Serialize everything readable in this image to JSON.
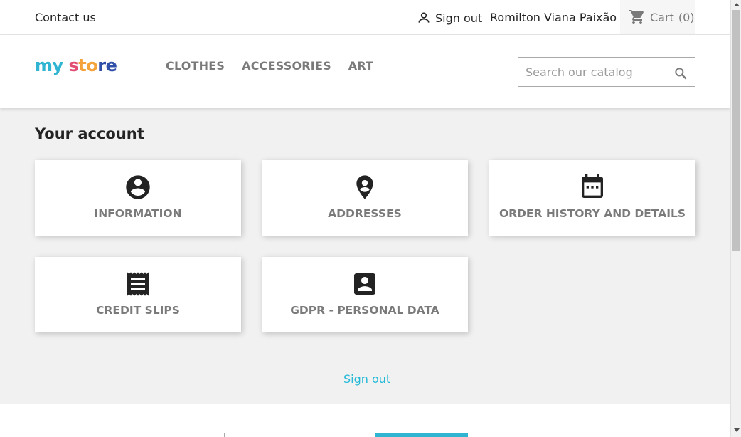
{
  "topbar": {
    "contact_label": "Contact us",
    "signout_label": "Sign out",
    "user_name": "Romilton Viana Paixão",
    "cart_label": "Cart",
    "cart_count": "(0)"
  },
  "header": {
    "logo_parts": [
      "my",
      " s",
      "to",
      "re"
    ],
    "nav": [
      {
        "label": "CLOTHES"
      },
      {
        "label": "ACCESSORIES"
      },
      {
        "label": "ART"
      }
    ],
    "search": {
      "placeholder": "Search our catalog",
      "value": ""
    }
  },
  "main": {
    "title": "Your account",
    "tiles": [
      {
        "label": "INFORMATION",
        "icon": "account-circle-icon"
      },
      {
        "label": "ADDRESSES",
        "icon": "location-pin-icon"
      },
      {
        "label": "ORDER HISTORY AND DETAILS",
        "icon": "calendar-icon"
      },
      {
        "label": "CREDIT SLIPS",
        "icon": "receipt-icon"
      },
      {
        "label": "GDPR - PERSONAL DATA",
        "icon": "contact-card-icon"
      }
    ],
    "signout_label": "Sign out"
  },
  "colors": {
    "accent": "#24b9d7",
    "text_muted": "#7a7a7a",
    "background": "#f1f1f1"
  }
}
